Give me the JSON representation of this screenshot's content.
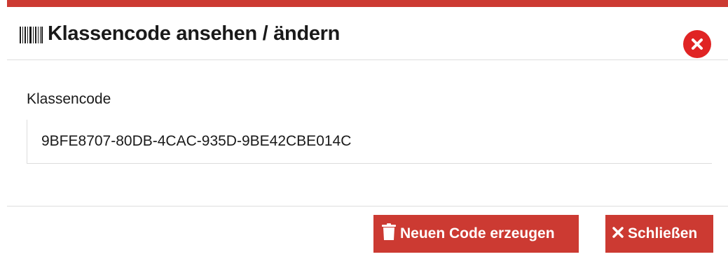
{
  "dialog": {
    "title": "Klassencode ansehen / ändern",
    "accent_color": "#cc3a32",
    "title_icon": "barcode-icon",
    "close_icon": "close-circle-icon"
  },
  "form": {
    "field_label": "Klassencode",
    "code_value": "9BFE8707-80DB-4CAC-935D-9BE42CBE014C"
  },
  "footer": {
    "new_code_button": {
      "label": "Neuen Code erzeugen",
      "icon": "trash-icon"
    },
    "close_button": {
      "label": "Schließen",
      "icon": "times-icon"
    }
  }
}
